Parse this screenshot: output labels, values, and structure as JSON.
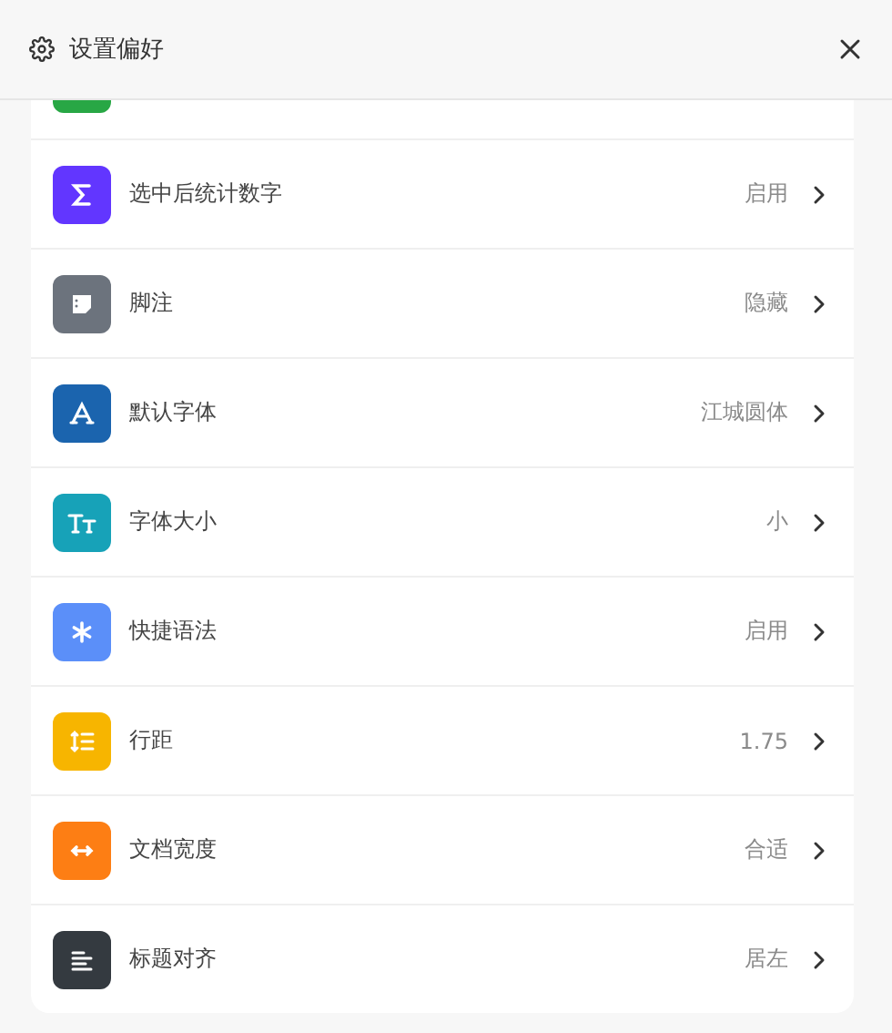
{
  "header": {
    "title": "设置偏好"
  },
  "items": [
    {
      "kind": "partial",
      "color": "#28a745"
    },
    {
      "kind": "sigma",
      "color": "#6236ff",
      "label": "选中后统计数字",
      "value": "启用"
    },
    {
      "kind": "note",
      "color": "#6c737d",
      "label": "脚注",
      "value": "隐藏"
    },
    {
      "kind": "font",
      "color": "#1b64ae",
      "label": "默认字体",
      "value": "江城圆体"
    },
    {
      "kind": "size",
      "color": "#17a2b8",
      "label": "字体大小",
      "value": "小"
    },
    {
      "kind": "asterisk",
      "color": "#5b8ff9",
      "label": "快捷语法",
      "value": "启用"
    },
    {
      "kind": "spacing",
      "color": "#f7b500",
      "label": "行距",
      "value": "1.75"
    },
    {
      "kind": "width",
      "color": "#fd7e14",
      "label": "文档宽度",
      "value": "合适"
    },
    {
      "kind": "align",
      "color": "#343a40",
      "label": "标题对齐",
      "value": "居左"
    }
  ]
}
